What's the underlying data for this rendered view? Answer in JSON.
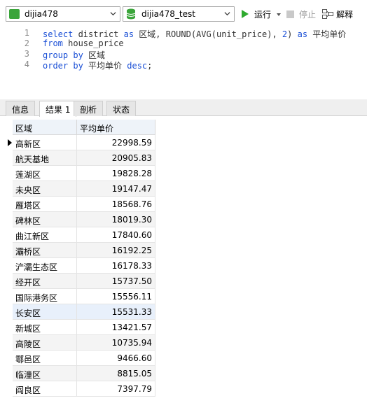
{
  "toolbar": {
    "connection": "dijia478",
    "database": "dijia478_test",
    "run_label": "运行",
    "stop_label": "停止",
    "explain_label": "解释"
  },
  "editor": {
    "lines": [
      {
        "no": "1",
        "text": "select district as 区域, ROUND(AVG(unit_price), 2) as 平均单价"
      },
      {
        "no": "2",
        "text": "from house_price"
      },
      {
        "no": "3",
        "text": "group by 区域"
      },
      {
        "no": "4",
        "text": "order by 平均单价 desc;"
      }
    ]
  },
  "tabs": [
    "信息",
    "结果 1",
    "剖析",
    "状态"
  ],
  "result": {
    "columns": [
      "区域",
      "平均单价"
    ],
    "rows": [
      [
        "高新区",
        "22998.59"
      ],
      [
        "航天基地",
        "20905.83"
      ],
      [
        "莲湖区",
        "19828.28"
      ],
      [
        "未央区",
        "19147.47"
      ],
      [
        "雁塔区",
        "18568.76"
      ],
      [
        "碑林区",
        "18019.30"
      ],
      [
        "曲江新区",
        "17840.60"
      ],
      [
        "灞桥区",
        "16192.25"
      ],
      [
        "浐灞生态区",
        "16178.33"
      ],
      [
        "经开区",
        "15737.50"
      ],
      [
        "国际港务区",
        "15556.11"
      ],
      [
        "长安区",
        "15531.33"
      ],
      [
        "新城区",
        "13421.57"
      ],
      [
        "高陵区",
        "10735.94"
      ],
      [
        "鄠邑区",
        "9466.60"
      ],
      [
        "临潼区",
        "8815.05"
      ],
      [
        "阎良区",
        "7397.79"
      ]
    ]
  },
  "colors": {
    "keyword": "#1a4fd6",
    "run_icon": "#2faa2f",
    "header_bg": "#eef3f9"
  }
}
